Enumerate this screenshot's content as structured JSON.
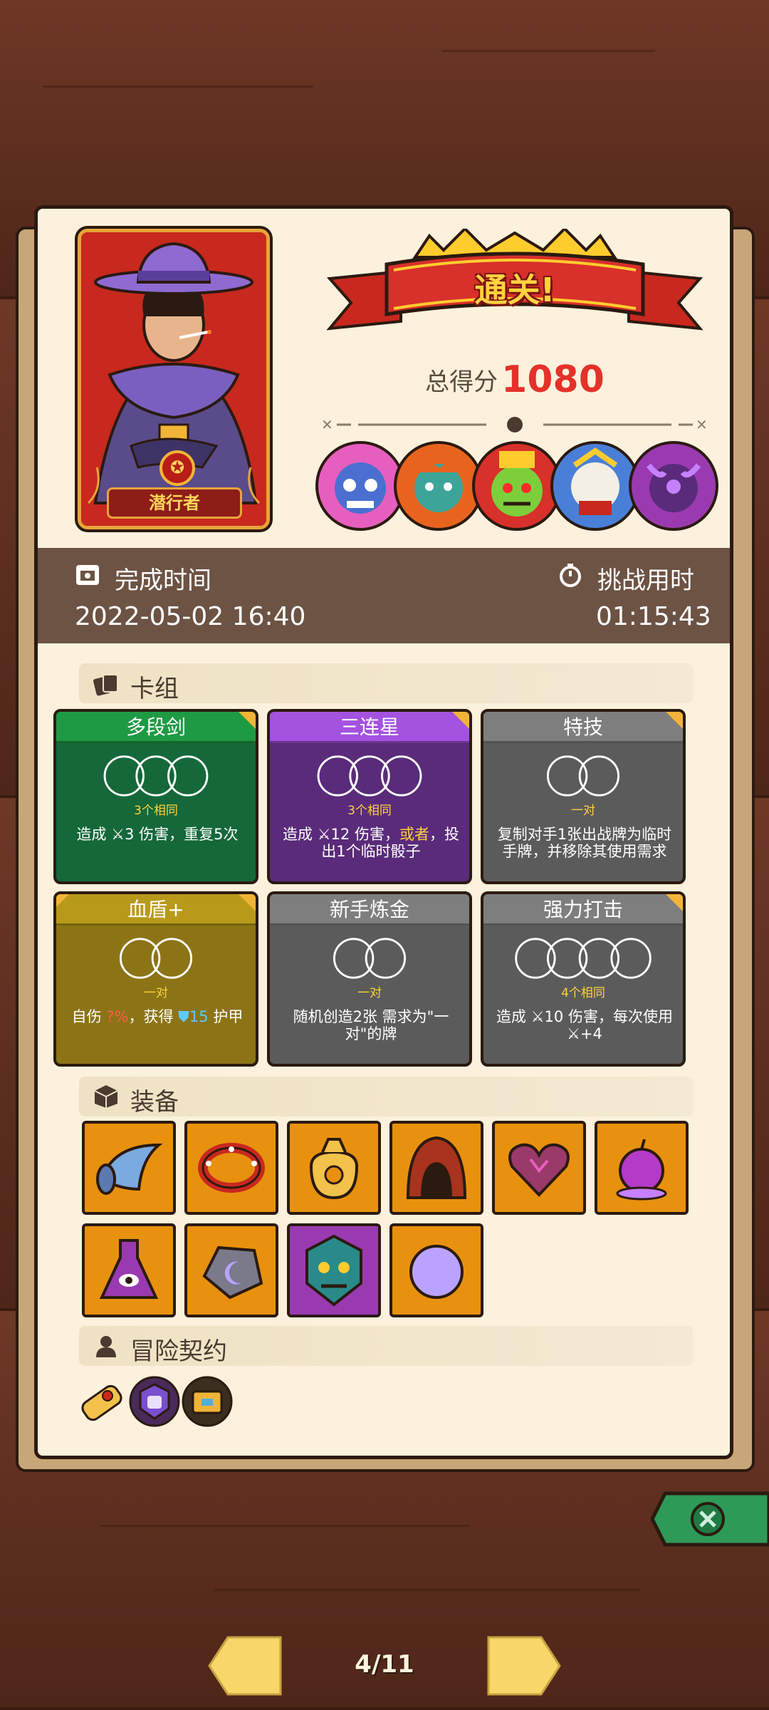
{
  "hero": {
    "name": "潜行者"
  },
  "result": {
    "banner": "通关!",
    "score_label": "总得分",
    "score_value": "1080"
  },
  "bosses": [
    "boss-1",
    "boss-2",
    "boss-3",
    "boss-4",
    "boss-5"
  ],
  "time": {
    "finish_label": "完成时间",
    "finish_value": "2022-05-02 16:40",
    "challenge_label": "挑战用时",
    "challenge_value": "01:15:43"
  },
  "sections": {
    "deck": "卡组",
    "equipment": "装备",
    "contract": "冒险契约"
  },
  "cards": [
    {
      "title": "多段剑",
      "req": "3个相同",
      "desc_pre": "造成 ",
      "desc_a": "3 伤害，重复5次",
      "desc_hl": "",
      "desc_post": "",
      "color": "#1f8a3d",
      "body": "#14683a",
      "dice": 3
    },
    {
      "title": "三连星",
      "req": "3个相同",
      "desc_pre": "造成 ",
      "desc_a": "12 伤害，",
      "desc_hl": "或者",
      "desc_post": "，投出1个临时骰子",
      "color": "#9a49cf",
      "body": "#5a2b7a",
      "dice": 3
    },
    {
      "title": "特技",
      "req": "一对",
      "desc_pre": "",
      "desc_a": "复制对手1张出战牌为临时手牌，并移除其使用需求",
      "desc_hl": "",
      "desc_post": "",
      "color": "#7a7a7a",
      "body": "#5b5b5b",
      "dice": 2
    },
    {
      "title": "血盾+",
      "req": "一对",
      "desc_pre": "自伤 ",
      "desc_a": "",
      "desc_hl": "",
      "desc_post": "",
      "color": "#b59617",
      "body": "#8c7416",
      "dice": 2,
      "self_dmg": "?%",
      "gain": "，获得 ",
      "shield": "15",
      "armor": " 护甲"
    },
    {
      "title": "新手炼金",
      "req": "一对",
      "desc_pre": "",
      "desc_a": "随机创造2张 需求为\"一对\"的牌",
      "desc_hl": "",
      "desc_post": "",
      "color": "#7a7a7a",
      "body": "#5b5b5b",
      "dice": 2
    },
    {
      "title": "强力打击",
      "req": "4个相同",
      "desc_pre": "造成 ",
      "desc_a": "10 伤害，每次使用",
      "desc_hl": "",
      "desc_post": "+4",
      "color": "#7a7a7a",
      "body": "#5b5b5b",
      "dice": 4
    }
  ],
  "equipment": [
    {
      "name": "horn-icon",
      "bg": "orange"
    },
    {
      "name": "spiked-collar-icon",
      "bg": "orange"
    },
    {
      "name": "coin-bag-icon",
      "bg": "orange"
    },
    {
      "name": "hood-icon",
      "bg": "orange"
    },
    {
      "name": "cursed-heart-icon",
      "bg": "orange"
    },
    {
      "name": "poison-apple-icon",
      "bg": "orange"
    },
    {
      "name": "eye-flask-icon",
      "bg": "orange"
    },
    {
      "name": "moon-stone-icon",
      "bg": "orange"
    },
    {
      "name": "demon-mask-icon",
      "bg": "purple"
    },
    {
      "name": "moon-orb-icon",
      "bg": "orange"
    }
  ],
  "contracts": [
    "scroll-icon",
    "fist-badge-icon",
    "gold-chest-icon"
  ],
  "pager": {
    "text": "4/11"
  },
  "colors": {
    "score": "#e5312a",
    "panel": "#fbf1dc",
    "band": "#6d5344"
  }
}
